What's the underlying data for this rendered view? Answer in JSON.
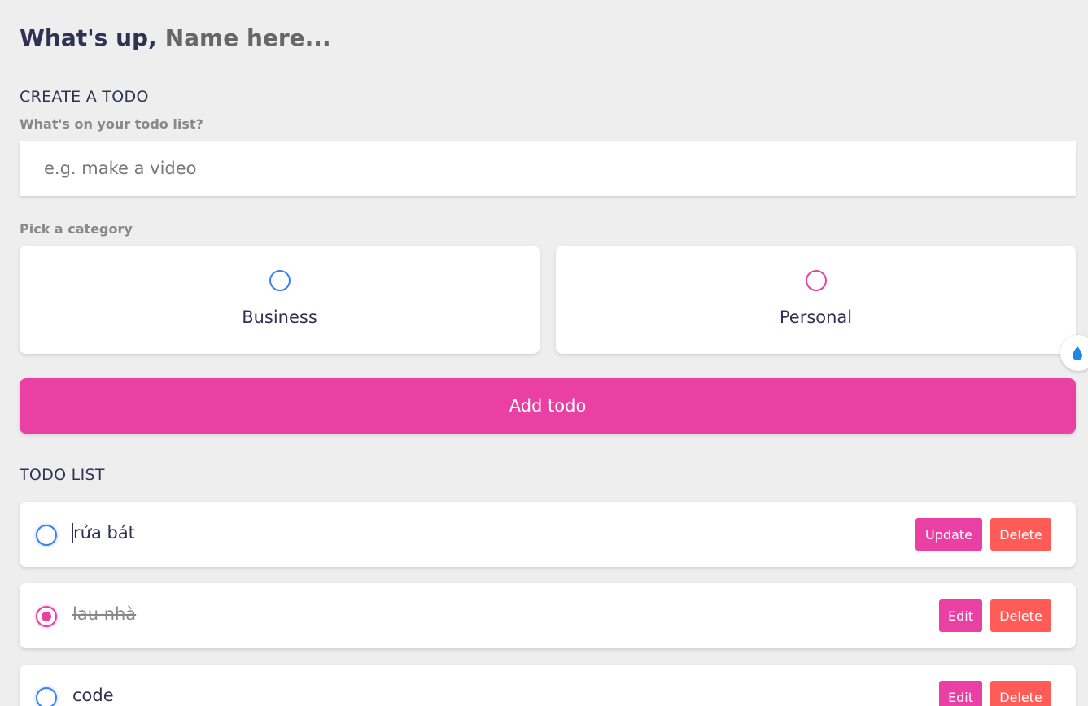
{
  "greeting": {
    "prefix": "What's up,",
    "name_placeholder": "Name here..."
  },
  "create": {
    "section_title": "CREATE A TODO",
    "input_label": "What's on your todo list?",
    "input_placeholder": "e.g. make a video",
    "input_value": "",
    "category_label": "Pick a category",
    "categories": [
      {
        "label": "Business",
        "color": "#3a82ee",
        "selected": false
      },
      {
        "label": "Personal",
        "color": "#ea40a4",
        "selected": false
      }
    ],
    "add_button": "Add todo"
  },
  "list": {
    "section_title": "TODO LIST",
    "items": [
      {
        "text": "rửa bát",
        "category": "business",
        "done": false,
        "editing": true,
        "primary_action": "Update",
        "delete_action": "Delete"
      },
      {
        "text": "lau nhà",
        "category": "personal",
        "done": true,
        "editing": false,
        "primary_action": "Edit",
        "delete_action": "Delete"
      },
      {
        "text": "code",
        "category": "business",
        "done": false,
        "editing": false,
        "primary_action": "Edit",
        "delete_action": "Delete"
      }
    ]
  },
  "colors": {
    "accent": "#ea40a4",
    "business": "#3a82ee",
    "danger": "#ff5b57",
    "background": "#eeeeee",
    "text_dark": "#313154"
  },
  "extension": {
    "icon": "water-drop-sparkle-icon"
  }
}
